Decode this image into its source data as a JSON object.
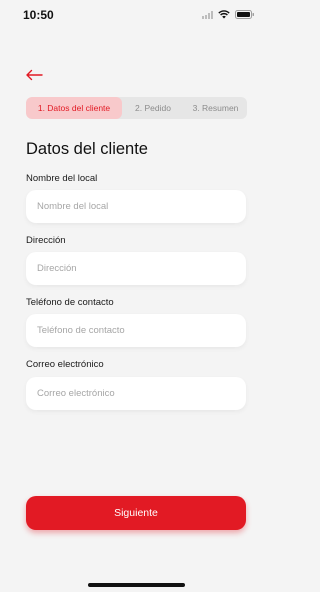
{
  "status_bar": {
    "time": "10:50",
    "icons": [
      "signal-icon",
      "wifi-icon",
      "battery-icon"
    ]
  },
  "colors": {
    "accent": "#e21a24",
    "accent_soft": "#f8c9cb",
    "background": "#f4f4f4",
    "input_background": "#ffffff"
  },
  "header": {
    "back_icon": "arrow-left-icon"
  },
  "stepper": {
    "steps": [
      {
        "label": "1. Datos del cliente",
        "active": true
      },
      {
        "label": "2. Pedido",
        "active": false
      },
      {
        "label": "3. Resumen",
        "active": false
      }
    ]
  },
  "form": {
    "title": "Datos del cliente",
    "fields": [
      {
        "label": "Nombre del local",
        "placeholder": "Nombre del local",
        "value": ""
      },
      {
        "label": "Dirección",
        "placeholder": "Dirección",
        "value": ""
      },
      {
        "label": "Teléfono de contacto",
        "placeholder": "Teléfono de contacto",
        "value": ""
      },
      {
        "label": "Correo electrónico",
        "placeholder": "Correo electrónico",
        "value": ""
      }
    ]
  },
  "actions": {
    "next_label": "Siguiente"
  }
}
